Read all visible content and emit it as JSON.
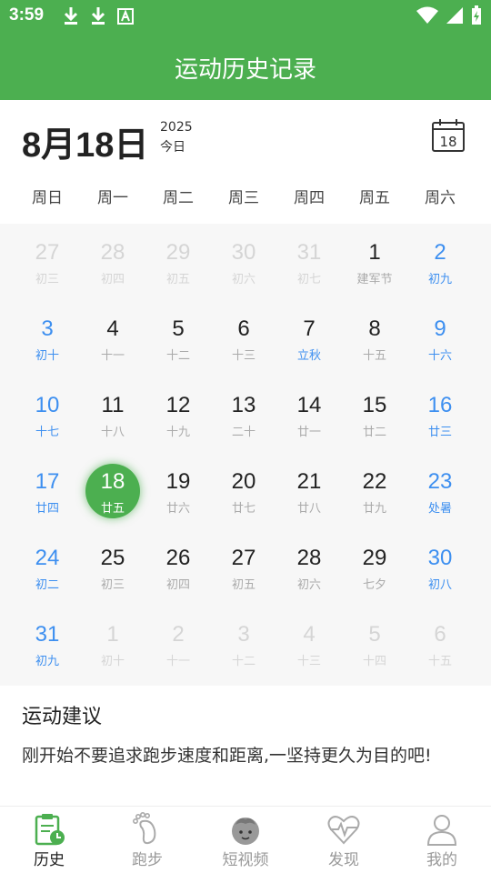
{
  "status": {
    "time": "3:59"
  },
  "appbar": {
    "title": "运动历史记录"
  },
  "header": {
    "date": "8月18日",
    "year": "2025",
    "today": "今日",
    "calendar_day": "18"
  },
  "weekdays": [
    "周日",
    "周一",
    "周二",
    "周三",
    "周四",
    "周五",
    "周六"
  ],
  "calendar": {
    "weeks": [
      [
        {
          "d": "27",
          "l": "初三",
          "t": "other"
        },
        {
          "d": "28",
          "l": "初四",
          "t": "other"
        },
        {
          "d": "29",
          "l": "初五",
          "t": "other"
        },
        {
          "d": "30",
          "l": "初六",
          "t": "other"
        },
        {
          "d": "31",
          "l": "初七",
          "t": "other"
        },
        {
          "d": "1",
          "l": "建军节",
          "t": "festival"
        },
        {
          "d": "2",
          "l": "初九",
          "t": "weekend"
        }
      ],
      [
        {
          "d": "3",
          "l": "初十",
          "t": "weekend"
        },
        {
          "d": "4",
          "l": "十一",
          "t": "normal"
        },
        {
          "d": "5",
          "l": "十二",
          "t": "normal"
        },
        {
          "d": "6",
          "l": "十三",
          "t": "normal"
        },
        {
          "d": "7",
          "l": "立秋",
          "t": "term"
        },
        {
          "d": "8",
          "l": "十五",
          "t": "normal"
        },
        {
          "d": "9",
          "l": "十六",
          "t": "weekend"
        }
      ],
      [
        {
          "d": "10",
          "l": "十七",
          "t": "weekend"
        },
        {
          "d": "11",
          "l": "十八",
          "t": "normal"
        },
        {
          "d": "12",
          "l": "十九",
          "t": "normal"
        },
        {
          "d": "13",
          "l": "二十",
          "t": "normal"
        },
        {
          "d": "14",
          "l": "廿一",
          "t": "normal"
        },
        {
          "d": "15",
          "l": "廿二",
          "t": "normal"
        },
        {
          "d": "16",
          "l": "廿三",
          "t": "weekend"
        }
      ],
      [
        {
          "d": "17",
          "l": "廿四",
          "t": "weekend"
        },
        {
          "d": "18",
          "l": "廿五",
          "t": "selected"
        },
        {
          "d": "19",
          "l": "廿六",
          "t": "normal"
        },
        {
          "d": "20",
          "l": "廿七",
          "t": "normal"
        },
        {
          "d": "21",
          "l": "廿八",
          "t": "normal"
        },
        {
          "d": "22",
          "l": "廿九",
          "t": "normal"
        },
        {
          "d": "23",
          "l": "处暑",
          "t": "weekend"
        }
      ],
      [
        {
          "d": "24",
          "l": "初二",
          "t": "weekend"
        },
        {
          "d": "25",
          "l": "初三",
          "t": "normal"
        },
        {
          "d": "26",
          "l": "初四",
          "t": "normal"
        },
        {
          "d": "27",
          "l": "初五",
          "t": "normal"
        },
        {
          "d": "28",
          "l": "初六",
          "t": "normal"
        },
        {
          "d": "29",
          "l": "七夕",
          "t": "normal"
        },
        {
          "d": "30",
          "l": "初八",
          "t": "weekend"
        }
      ],
      [
        {
          "d": "31",
          "l": "初九",
          "t": "weekend"
        },
        {
          "d": "1",
          "l": "初十",
          "t": "other"
        },
        {
          "d": "2",
          "l": "十一",
          "t": "other"
        },
        {
          "d": "3",
          "l": "十二",
          "t": "other"
        },
        {
          "d": "4",
          "l": "十三",
          "t": "other"
        },
        {
          "d": "5",
          "l": "十四",
          "t": "other"
        },
        {
          "d": "6",
          "l": "十五",
          "t": "other"
        }
      ]
    ]
  },
  "advice": {
    "title": "运动建议",
    "text": "刚开始不要追求跑步速度和距离,一坚持更久为目的吧!"
  },
  "nav": {
    "history": "历史",
    "running": "跑步",
    "video": "短视频",
    "discover": "发现",
    "mine": "我的"
  },
  "colors": {
    "primary": "#4caf50",
    "weekend": "#3d8ff0"
  }
}
